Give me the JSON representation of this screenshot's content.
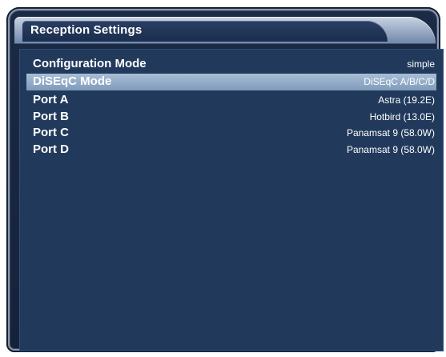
{
  "window": {
    "title": "Reception Settings"
  },
  "settings": {
    "items": [
      {
        "label": "Configuration Mode",
        "value": "simple",
        "selected": false
      },
      {
        "label": "DiSEqC Mode",
        "value": "DiSEqC A/B/C/D",
        "selected": true
      },
      {
        "label": "Port A",
        "value": "Astra (19.2E)",
        "selected": false
      },
      {
        "label": "Port B",
        "value": "Hotbird (13.0E)",
        "selected": false
      },
      {
        "label": "Port C",
        "value": "Panamsat 9 (58.0W)",
        "selected": false
      },
      {
        "label": "Port D",
        "value": "Panamsat 9 (58.0W)",
        "selected": false
      }
    ]
  },
  "colors": {
    "panel_background": "#213a5c",
    "selection_highlight": "#8fa8c6",
    "text": "#ffffff"
  }
}
